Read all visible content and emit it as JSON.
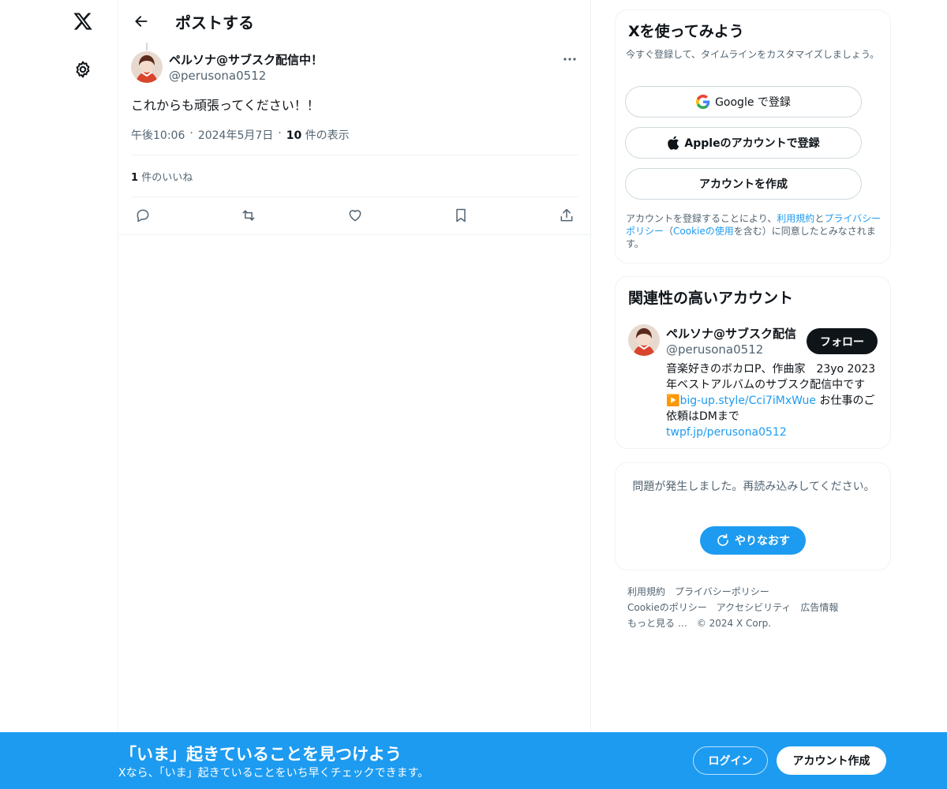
{
  "nav": {
    "logo_icon": "x-logo-icon",
    "settings_icon": "gear-icon"
  },
  "header": {
    "title": "ポストする"
  },
  "post": {
    "author_name": "ペルソナ@サブスク配信中！",
    "author_handle": "@perusona0512",
    "text": "これからも頑張ってください！！",
    "time": "午後10:06",
    "date": "2024年5月7日",
    "views_count": "10",
    "views_label": "件の表示",
    "likes_count": "1",
    "likes_label": "件のいいね"
  },
  "signup_card": {
    "title": "Xを使ってみよう",
    "description": "今すぐ登録して、タイムラインをカスタマイズしましょう。",
    "google_label": "Google で登録",
    "apple_label": "Appleのアカウントで登録",
    "create_label": "アカウントを作成",
    "terms_prefix": "アカウントを登録することにより、",
    "terms_link": "利用規約",
    "terms_and": "と",
    "privacy_link": "プライバシーポリシー",
    "cookie_open": "（",
    "cookie_link": "Cookieの使用",
    "terms_suffix": "を含む）に同意したとみなされます。"
  },
  "related_card": {
    "title": "関連性の高いアカウント",
    "name": "ペルソナ@サブスク配信",
    "handle": "@perusona0512",
    "follow_label": "フォロー",
    "bio_text": "音楽好きのボカロP、作曲家　23yo 2023年ベストアルバムのサブスク配信中です",
    "bio_emoji": "▶️",
    "bio_link1": "big-up.style/Cci7iMxWue",
    "bio_mid": " お仕事のご依頼はDMまで",
    "bio_link2": "twpf.jp/perusona0512"
  },
  "error_card": {
    "message": "問題が発生しました。再読み込みしてください。",
    "retry_label": "やりなおす"
  },
  "footer": {
    "links": [
      "利用規約",
      "プライバシーポリシー",
      "Cookieのポリシー",
      "アクセシビリティ",
      "広告情報",
      "もっと見る …",
      "© 2024 X Corp."
    ]
  },
  "bottom_bar": {
    "title": "「いま」起きていることを見つけよう",
    "subtitle": "Xなら、「いま」起きていることをいち早くチェックできます。",
    "login_label": "ログイン",
    "create_label": "アカウント作成"
  },
  "colors": {
    "accent": "#1d9bf0",
    "text": "#0f1419",
    "muted": "#536471",
    "border": "#eff3f4"
  }
}
